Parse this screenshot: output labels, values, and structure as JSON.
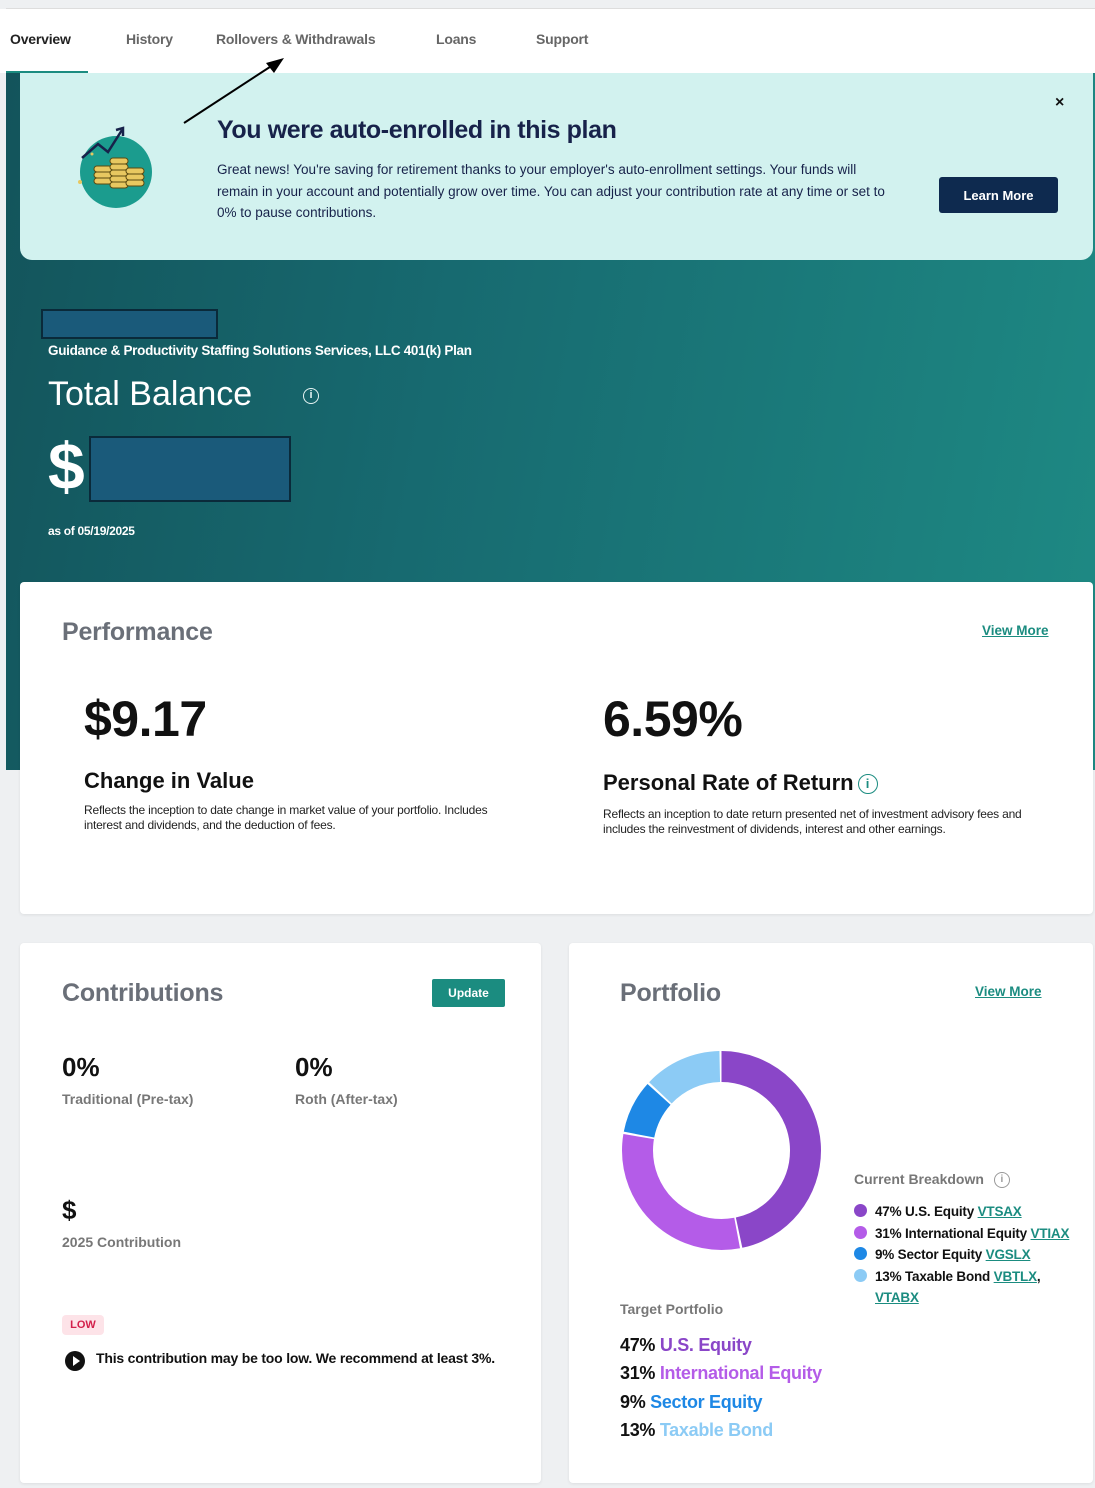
{
  "nav": {
    "items": [
      {
        "label": "Overview"
      },
      {
        "label": "History"
      },
      {
        "label": "Rollovers & Withdrawals"
      },
      {
        "label": "Loans"
      },
      {
        "label": "Support"
      }
    ],
    "active": "Overview"
  },
  "banner": {
    "title": "You were auto-enrolled in this plan",
    "body": "Great news! You're saving for retirement thanks to your employer's auto-enrollment settings. Your funds will remain in your account and potentially grow over time. You can adjust your contribution rate at any time or set to 0% to pause contributions.",
    "button": "Learn More",
    "close": "×"
  },
  "account": {
    "plan_name": "Guidance & Productivity Staffing Solutions Services, LLC 401(k) Plan",
    "total_label": "Total Balance",
    "currency_symbol": "$",
    "as_of": "as of 05/19/2025"
  },
  "performance": {
    "title": "Performance",
    "view_more": "View More",
    "change_value": "$9.17",
    "change_label": "Change in Value",
    "change_desc": "Reflects the inception to date change in market value of your portfolio. Includes interest and dividends, and the deduction of fees.",
    "rate_value": "6.59%",
    "rate_label": "Personal Rate of Return",
    "rate_desc": "Reflects an inception to date return presented net of investment advisory fees and includes the reinvestment of dividends, interest and other earnings."
  },
  "contributions": {
    "title": "Contributions",
    "update": "Update",
    "traditional_pct": "0%",
    "traditional_label": "Traditional (Pre-tax)",
    "roth_pct": "0%",
    "roth_label": "Roth (After-tax)",
    "ytd_amount": "$",
    "ytd_label": "2025 Contribution",
    "badge": "LOW",
    "warning": "This contribution may be too low. We recommend at least 3%."
  },
  "portfolio": {
    "title": "Portfolio",
    "view_more": "View More",
    "breakdown_title": "Current Breakdown",
    "target_title": "Target Portfolio",
    "segments": [
      {
        "pct": "47%",
        "name": "U.S. Equity",
        "tickers": [
          "VTSAX"
        ],
        "value": 47,
        "color": "#8a46c8"
      },
      {
        "pct": "31%",
        "name": "International Equity",
        "tickers": [
          "VTIAX"
        ],
        "value": 31,
        "color": "#b45ce8"
      },
      {
        "pct": "9%",
        "name": "Sector Equity",
        "tickers": [
          "VGSLX"
        ],
        "value": 9,
        "color": "#1e88e5"
      },
      {
        "pct": "13%",
        "name": "Taxable Bond",
        "tickers": [
          "VBTLX",
          "VTABX"
        ],
        "value": 13,
        "color": "#8ccbf5"
      }
    ]
  }
}
